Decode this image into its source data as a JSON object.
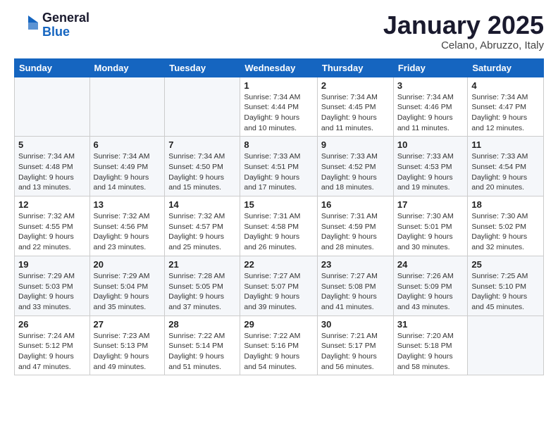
{
  "header": {
    "logo_general": "General",
    "logo_blue": "Blue",
    "month": "January 2025",
    "location": "Celano, Abruzzo, Italy"
  },
  "weekdays": [
    "Sunday",
    "Monday",
    "Tuesday",
    "Wednesday",
    "Thursday",
    "Friday",
    "Saturday"
  ],
  "weeks": [
    [
      {
        "day": "",
        "info": ""
      },
      {
        "day": "",
        "info": ""
      },
      {
        "day": "",
        "info": ""
      },
      {
        "day": "1",
        "info": "Sunrise: 7:34 AM\nSunset: 4:44 PM\nDaylight: 9 hours and 10 minutes."
      },
      {
        "day": "2",
        "info": "Sunrise: 7:34 AM\nSunset: 4:45 PM\nDaylight: 9 hours and 11 minutes."
      },
      {
        "day": "3",
        "info": "Sunrise: 7:34 AM\nSunset: 4:46 PM\nDaylight: 9 hours and 11 minutes."
      },
      {
        "day": "4",
        "info": "Sunrise: 7:34 AM\nSunset: 4:47 PM\nDaylight: 9 hours and 12 minutes."
      }
    ],
    [
      {
        "day": "5",
        "info": "Sunrise: 7:34 AM\nSunset: 4:48 PM\nDaylight: 9 hours and 13 minutes."
      },
      {
        "day": "6",
        "info": "Sunrise: 7:34 AM\nSunset: 4:49 PM\nDaylight: 9 hours and 14 minutes."
      },
      {
        "day": "7",
        "info": "Sunrise: 7:34 AM\nSunset: 4:50 PM\nDaylight: 9 hours and 15 minutes."
      },
      {
        "day": "8",
        "info": "Sunrise: 7:33 AM\nSunset: 4:51 PM\nDaylight: 9 hours and 17 minutes."
      },
      {
        "day": "9",
        "info": "Sunrise: 7:33 AM\nSunset: 4:52 PM\nDaylight: 9 hours and 18 minutes."
      },
      {
        "day": "10",
        "info": "Sunrise: 7:33 AM\nSunset: 4:53 PM\nDaylight: 9 hours and 19 minutes."
      },
      {
        "day": "11",
        "info": "Sunrise: 7:33 AM\nSunset: 4:54 PM\nDaylight: 9 hours and 20 minutes."
      }
    ],
    [
      {
        "day": "12",
        "info": "Sunrise: 7:32 AM\nSunset: 4:55 PM\nDaylight: 9 hours and 22 minutes."
      },
      {
        "day": "13",
        "info": "Sunrise: 7:32 AM\nSunset: 4:56 PM\nDaylight: 9 hours and 23 minutes."
      },
      {
        "day": "14",
        "info": "Sunrise: 7:32 AM\nSunset: 4:57 PM\nDaylight: 9 hours and 25 minutes."
      },
      {
        "day": "15",
        "info": "Sunrise: 7:31 AM\nSunset: 4:58 PM\nDaylight: 9 hours and 26 minutes."
      },
      {
        "day": "16",
        "info": "Sunrise: 7:31 AM\nSunset: 4:59 PM\nDaylight: 9 hours and 28 minutes."
      },
      {
        "day": "17",
        "info": "Sunrise: 7:30 AM\nSunset: 5:01 PM\nDaylight: 9 hours and 30 minutes."
      },
      {
        "day": "18",
        "info": "Sunrise: 7:30 AM\nSunset: 5:02 PM\nDaylight: 9 hours and 32 minutes."
      }
    ],
    [
      {
        "day": "19",
        "info": "Sunrise: 7:29 AM\nSunset: 5:03 PM\nDaylight: 9 hours and 33 minutes."
      },
      {
        "day": "20",
        "info": "Sunrise: 7:29 AM\nSunset: 5:04 PM\nDaylight: 9 hours and 35 minutes."
      },
      {
        "day": "21",
        "info": "Sunrise: 7:28 AM\nSunset: 5:05 PM\nDaylight: 9 hours and 37 minutes."
      },
      {
        "day": "22",
        "info": "Sunrise: 7:27 AM\nSunset: 5:07 PM\nDaylight: 9 hours and 39 minutes."
      },
      {
        "day": "23",
        "info": "Sunrise: 7:27 AM\nSunset: 5:08 PM\nDaylight: 9 hours and 41 minutes."
      },
      {
        "day": "24",
        "info": "Sunrise: 7:26 AM\nSunset: 5:09 PM\nDaylight: 9 hours and 43 minutes."
      },
      {
        "day": "25",
        "info": "Sunrise: 7:25 AM\nSunset: 5:10 PM\nDaylight: 9 hours and 45 minutes."
      }
    ],
    [
      {
        "day": "26",
        "info": "Sunrise: 7:24 AM\nSunset: 5:12 PM\nDaylight: 9 hours and 47 minutes."
      },
      {
        "day": "27",
        "info": "Sunrise: 7:23 AM\nSunset: 5:13 PM\nDaylight: 9 hours and 49 minutes."
      },
      {
        "day": "28",
        "info": "Sunrise: 7:22 AM\nSunset: 5:14 PM\nDaylight: 9 hours and 51 minutes."
      },
      {
        "day": "29",
        "info": "Sunrise: 7:22 AM\nSunset: 5:16 PM\nDaylight: 9 hours and 54 minutes."
      },
      {
        "day": "30",
        "info": "Sunrise: 7:21 AM\nSunset: 5:17 PM\nDaylight: 9 hours and 56 minutes."
      },
      {
        "day": "31",
        "info": "Sunrise: 7:20 AM\nSunset: 5:18 PM\nDaylight: 9 hours and 58 minutes."
      },
      {
        "day": "",
        "info": ""
      }
    ]
  ]
}
